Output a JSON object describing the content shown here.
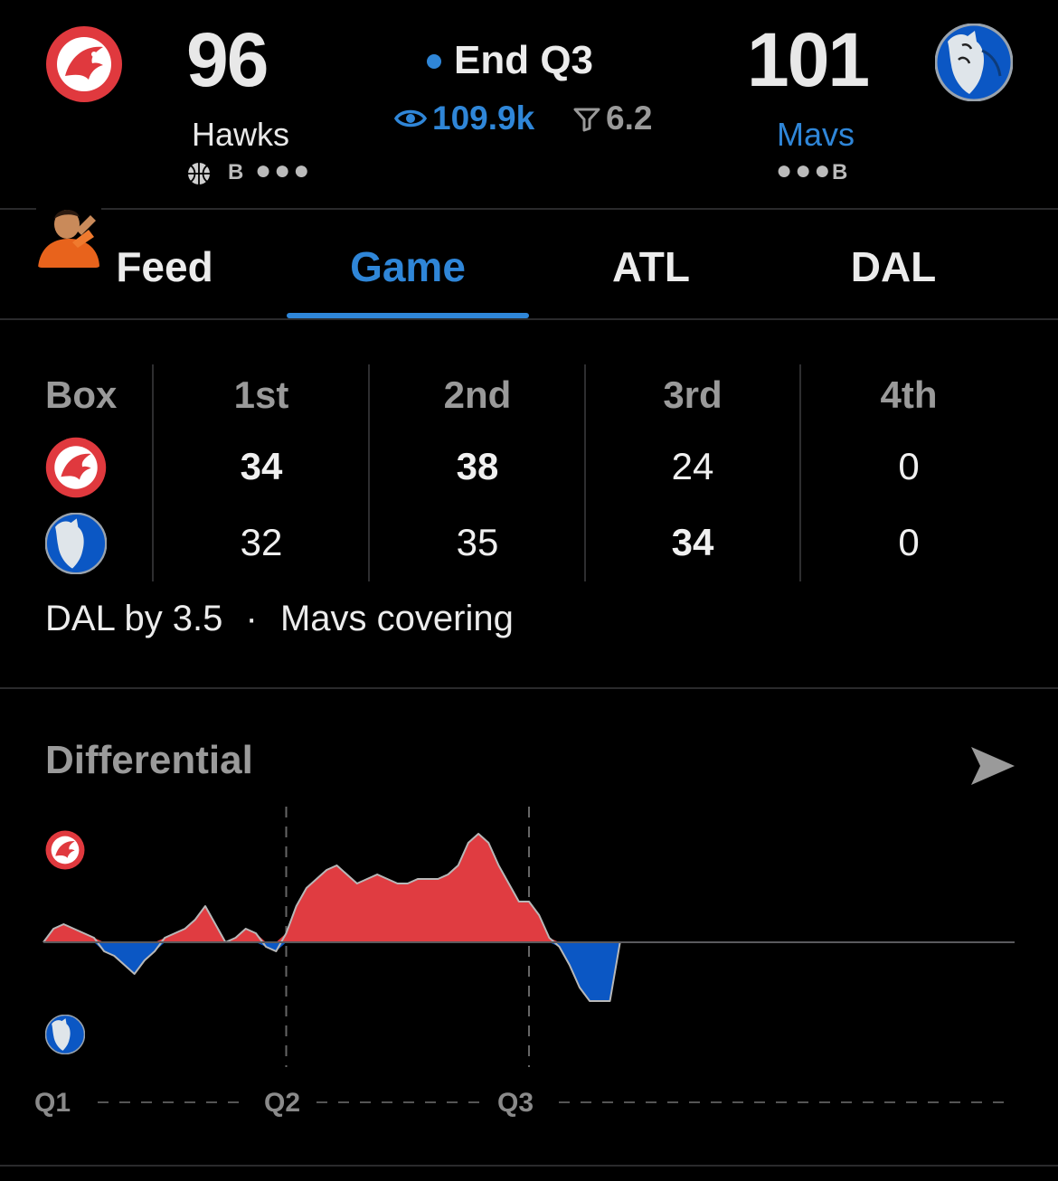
{
  "header": {
    "home": {
      "score": "96",
      "name": "Hawks",
      "sub_letter": "B",
      "logo_icon": "hawks-logo-icon",
      "name_color": "#e8e8e8"
    },
    "away": {
      "score": "101",
      "name": "Mavs",
      "sub_letter": "B",
      "logo_icon": "mavs-logo-icon",
      "name_color": "#2f86d8"
    },
    "status": "End Q3",
    "viewers": "109.9k",
    "rating": "6.2"
  },
  "tabs": [
    {
      "label": "Feed"
    },
    {
      "label": "Game"
    },
    {
      "label": "ATL"
    },
    {
      "label": "DAL"
    }
  ],
  "active_tab": "Game",
  "box": {
    "header_label": "Box",
    "periods": [
      "1st",
      "2nd",
      "3rd",
      "4th"
    ],
    "home_scores": [
      "34",
      "38",
      "24",
      "0"
    ],
    "away_scores": [
      "32",
      "35",
      "34",
      "0"
    ],
    "summary_line": "DAL by 3.5",
    "summary_sep": "·",
    "summary_status": "Mavs covering"
  },
  "differential": {
    "title": "Differential",
    "share_icon": "send-icon",
    "quarter_labels": [
      "Q1",
      "Q2",
      "Q3"
    ],
    "colors": {
      "home": "#e03c41",
      "away": "#0b57c4",
      "baseline": "#5a5a5e"
    }
  },
  "chart_data": {
    "type": "area",
    "title": "Differential",
    "xlabel": "",
    "ylabel": "",
    "x_ticks": [
      "Q1",
      "Q2",
      "Q3"
    ],
    "x_range": [
      0,
      48
    ],
    "ylim": [
      -15,
      15
    ],
    "series": [
      {
        "x": [
          0,
          0.5,
          1,
          1.5,
          2,
          2.5,
          3,
          3.5,
          4,
          4.5,
          5,
          5.5,
          6,
          6.5,
          7,
          7.5,
          8,
          8.5,
          9,
          9.5,
          10,
          10.5,
          11,
          11.5,
          12,
          12.5,
          13,
          13.5,
          14,
          14.5,
          15,
          15.5,
          16,
          16.5,
          17,
          17.5,
          18,
          18.5,
          19,
          19.5,
          20,
          20.5,
          21,
          21.5,
          22,
          22.5,
          23,
          23.5,
          24,
          24.5,
          25,
          25.5,
          26,
          26.5,
          27,
          27.5,
          28,
          28.5,
          29,
          29.5,
          30,
          30.5,
          31,
          31.5,
          32,
          32.5,
          33,
          33.5,
          34,
          34.5,
          35,
          35.5,
          36,
          36.5,
          37,
          37.5,
          38
        ],
        "y": [
          0,
          3,
          4,
          3,
          2,
          1,
          -2,
          -3,
          -5,
          -7,
          -4,
          -2,
          1,
          2,
          3,
          5,
          8,
          4,
          0,
          1,
          3,
          2,
          -1,
          -2,
          2,
          8,
          12,
          14,
          16,
          17,
          15,
          13,
          14,
          15,
          14,
          13,
          13,
          14,
          14,
          14,
          15,
          17,
          22,
          24,
          22,
          17,
          13,
          9,
          9,
          6,
          1,
          -1,
          -5,
          -10,
          -13,
          -13,
          -13,
          0,
          0,
          0,
          0,
          0,
          0,
          0,
          0,
          0,
          0,
          0,
          0,
          0,
          0,
          0,
          0,
          0,
          0,
          0,
          0
        ]
      }
    ],
    "grid": false
  }
}
